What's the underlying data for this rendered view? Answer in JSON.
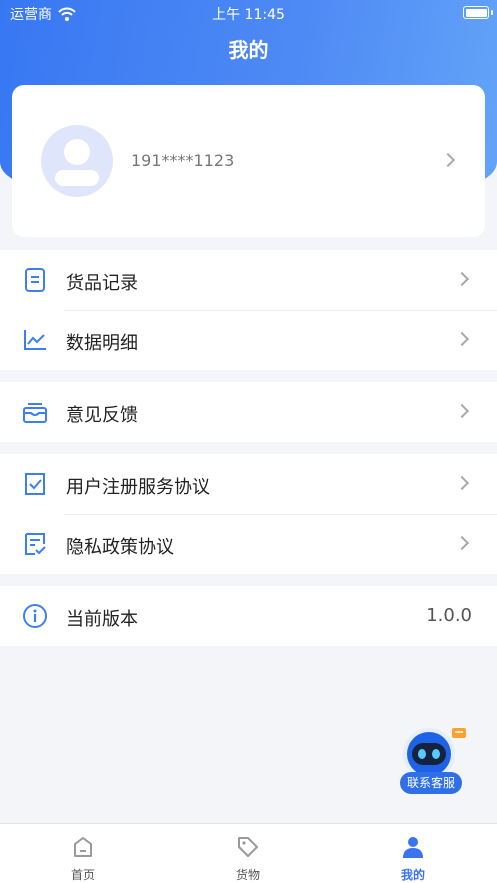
{
  "status_bar": {
    "carrier": "运营商",
    "time": "上午 11:45"
  },
  "header": {
    "title": "我的"
  },
  "profile": {
    "phone": "191****1123"
  },
  "menu_groups": [
    [
      {
        "label": "货品记录",
        "icon": "document-icon"
      },
      {
        "label": "数据明细",
        "icon": "line-chart-icon"
      }
    ],
    [
      {
        "label": "意见反馈",
        "icon": "inbox-icon"
      }
    ],
    [
      {
        "label": "用户注册服务协议",
        "icon": "checked-doc-icon"
      },
      {
        "label": "隐私政策协议",
        "icon": "list-check-icon"
      }
    ],
    [
      {
        "label": "当前版本",
        "icon": "info-icon",
        "value": "1.0.0"
      }
    ]
  ],
  "customer_service": {
    "label": "联系客服"
  },
  "tabbar": {
    "items": [
      {
        "label": "首页",
        "icon": "home-icon"
      },
      {
        "label": "货物",
        "icon": "tag-icon"
      },
      {
        "label": "我的",
        "icon": "user-icon"
      }
    ],
    "active": "我的"
  },
  "colors": {
    "accent": "#3b74ee",
    "hero_gradient": [
      "#3777f2",
      "#63a4f8"
    ],
    "icon_blue": "#3c7ff0"
  }
}
